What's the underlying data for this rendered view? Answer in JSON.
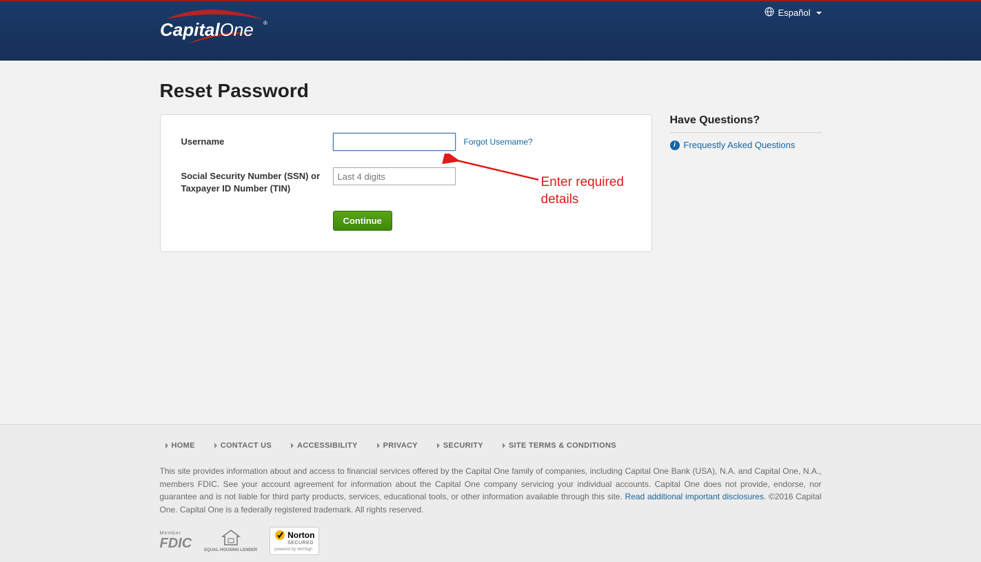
{
  "header": {
    "brand_primary": "Capital",
    "brand_secondary": "One",
    "lang_label": "Español"
  },
  "page": {
    "title": "Reset Password",
    "username_label": "Username",
    "forgot_username": "Forgot Username?",
    "ssn_label": "Social Security Number (SSN) or Taxpayer ID Number (TIN)",
    "ssn_placeholder": "Last 4 digits",
    "continue_label": "Continue"
  },
  "sidebar": {
    "title": "Have Questions?",
    "faq_label": "Frequestly Asked Questions"
  },
  "annotation": {
    "text": "Enter required details"
  },
  "footer": {
    "nav": [
      "HOME",
      "CONTACT US",
      "ACCESSIBILITY",
      "PRIVACY",
      "SECURITY",
      "SITE TERMS & CONDITIONS"
    ],
    "disclosure_1": "This site provides information about and access to financial services offered by the Capital One family of companies, including Capital One Bank (USA), N.A. and Capital One, N.A., members FDIC. See your account agreement for information about the Capital One company servicing your individual accounts. Capital One does not provide, endorse, nor guarantee and is not liable for third party products, services, educational tools, or other information available through this site. ",
    "disclosure_link": "Read additional important disclosures",
    "disclosure_2": ". ©2016 Capital One. Capital One is a federally registered trademark. All rights reserved.",
    "badge_fdic_top": "Member",
    "badge_fdic": "FDIC",
    "badge_ehl": "EQUAL HOUSING LENDER",
    "badge_norton": "Norton",
    "badge_norton_sub": "SECURED",
    "badge_norton_small": "powered by VeriSign"
  }
}
